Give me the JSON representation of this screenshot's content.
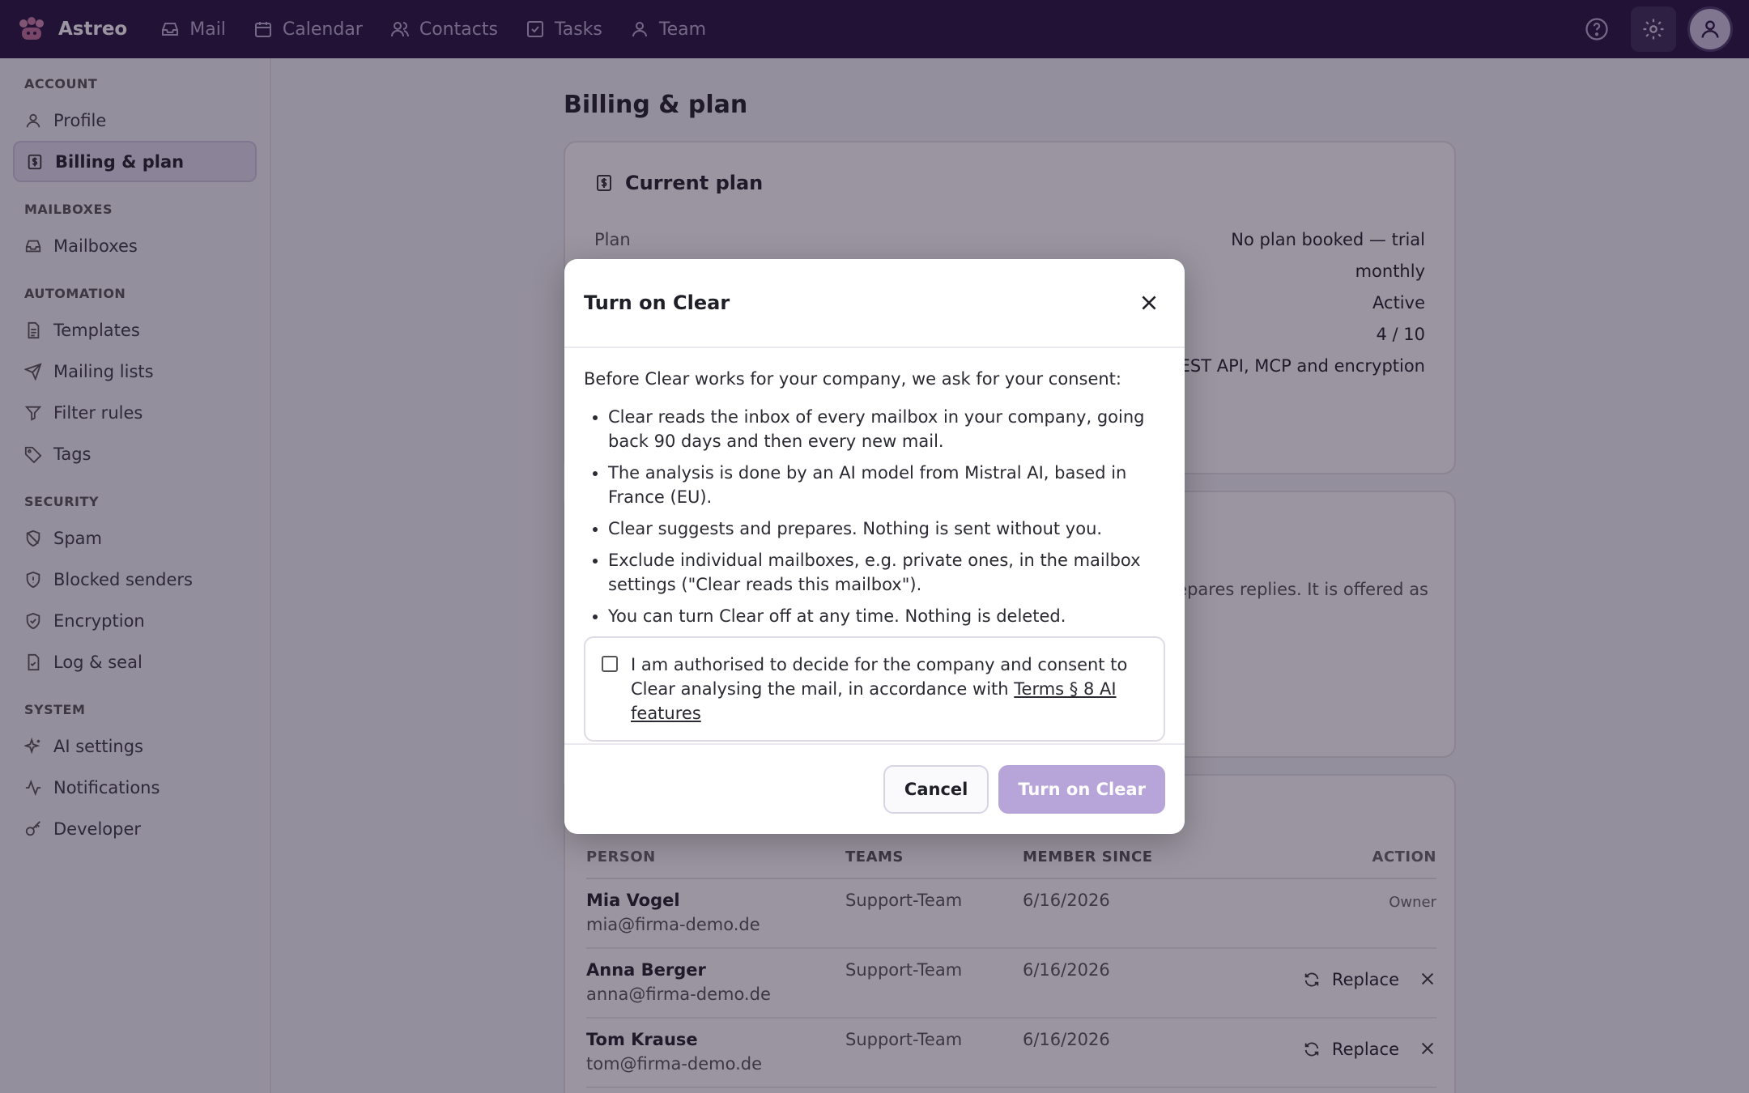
{
  "app": {
    "brand": "Astreo",
    "nav": [
      {
        "label": "Mail",
        "icon": "inbox-icon"
      },
      {
        "label": "Calendar",
        "icon": "calendar-icon"
      },
      {
        "label": "Contacts",
        "icon": "contacts-icon"
      },
      {
        "label": "Tasks",
        "icon": "checkbox-icon"
      },
      {
        "label": "Team",
        "icon": "user-icon"
      }
    ]
  },
  "sidebar": {
    "sections": [
      {
        "title": "ACCOUNT",
        "items": [
          {
            "label": "Profile",
            "icon": "user-icon"
          },
          {
            "label": "Billing & plan",
            "icon": "dollar-icon",
            "active": true
          }
        ]
      },
      {
        "title": "MAILBOXES",
        "items": [
          {
            "label": "Mailboxes",
            "icon": "inbox-icon"
          }
        ]
      },
      {
        "title": "AUTOMATION",
        "items": [
          {
            "label": "Templates",
            "icon": "document-icon"
          },
          {
            "label": "Mailing lists",
            "icon": "send-icon"
          },
          {
            "label": "Filter rules",
            "icon": "filter-icon"
          },
          {
            "label": "Tags",
            "icon": "tag-icon"
          }
        ]
      },
      {
        "title": "SECURITY",
        "items": [
          {
            "label": "Spam",
            "icon": "spam-shield-icon"
          },
          {
            "label": "Blocked senders",
            "icon": "shield-alert-icon"
          },
          {
            "label": "Encryption",
            "icon": "shield-check-icon"
          },
          {
            "label": "Log & seal",
            "icon": "file-check-icon"
          }
        ]
      },
      {
        "title": "SYSTEM",
        "items": [
          {
            "label": "AI settings",
            "icon": "sparkles-icon"
          },
          {
            "label": "Notifications",
            "icon": "activity-icon"
          },
          {
            "label": "Developer",
            "icon": "key-icon"
          }
        ]
      }
    ]
  },
  "page": {
    "title": "Billing & plan",
    "current_plan": {
      "heading": "Current plan",
      "rows": [
        {
          "key": "Plan",
          "value": "No plan booked — trial"
        },
        {
          "key": "",
          "value": "monthly"
        },
        {
          "key": "",
          "value": "Active"
        },
        {
          "key": "",
          "value": "4 / 10"
        },
        {
          "key": "",
          "value": "REST API, MCP and encryption"
        }
      ]
    },
    "clear_card_text": "repares replies. It is offered as",
    "members_table": {
      "headers": {
        "person": "PERSON",
        "teams": "TEAMS",
        "since": "MEMBER SINCE",
        "action": "ACTION"
      },
      "rows": [
        {
          "name": "Mia Vogel",
          "email": "mia@firma-demo.de",
          "team": "Support-Team",
          "since": "6/16/2026",
          "role": "Owner"
        },
        {
          "name": "Anna Berger",
          "email": "anna@firma-demo.de",
          "team": "Support-Team",
          "since": "6/16/2026",
          "action": "Replace"
        },
        {
          "name": "Tom Krause",
          "email": "tom@firma-demo.de",
          "team": "Support-Team",
          "since": "6/16/2026",
          "action": "Replace"
        }
      ]
    }
  },
  "modal": {
    "title": "Turn on Clear",
    "intro": "Before Clear works for your company, we ask for your consent:",
    "bullets": [
      "Clear reads the inbox of every mailbox in your company, going back 90 days and then every new mail.",
      "The analysis is done by an AI model from Mistral AI, based in France (EU).",
      "Clear suggests and prepares. Nothing is sent without you.",
      "Exclude individual mailboxes, e.g. private ones, in the mailbox settings (\"Clear reads this mailbox\").",
      "You can turn Clear off at any time. Nothing is deleted."
    ],
    "consent_text": "I am authorised to decide for the company and consent to Clear analysing the mail, in accordance with",
    "consent_link": "Terms § 8 AI features",
    "consent_checked": false,
    "cancel_label": "Cancel",
    "confirm_label": "Turn on Clear"
  },
  "colors": {
    "topbar": "#24123f",
    "accent": "#b7a4d8",
    "active_bg": "#e4def0"
  }
}
